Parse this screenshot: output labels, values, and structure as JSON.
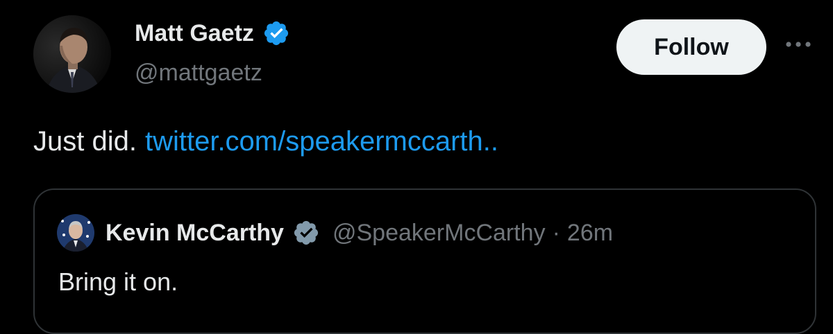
{
  "tweet": {
    "author": {
      "name": "Matt Gaetz",
      "handle": "@mattgaetz",
      "verified": true,
      "verified_color": "#1d9bf0"
    },
    "follow_label": "Follow",
    "more_icon": "more-horizontal-icon",
    "text": "Just did.",
    "link_text": "twitter.com/speakermccarth..",
    "link_color": "#1d9bf0"
  },
  "quote": {
    "author": {
      "name": "Kevin McCarthy",
      "handle": "@SpeakerMcCarthy",
      "verified": true,
      "verified_color": "#829aab"
    },
    "separator": "·",
    "time": "26m",
    "text": "Bring it on."
  },
  "colors": {
    "background": "#000000",
    "primary_text": "#e7e9ea",
    "secondary_text": "#71767b",
    "border": "#2f3336",
    "button_bg": "#eff3f4"
  }
}
